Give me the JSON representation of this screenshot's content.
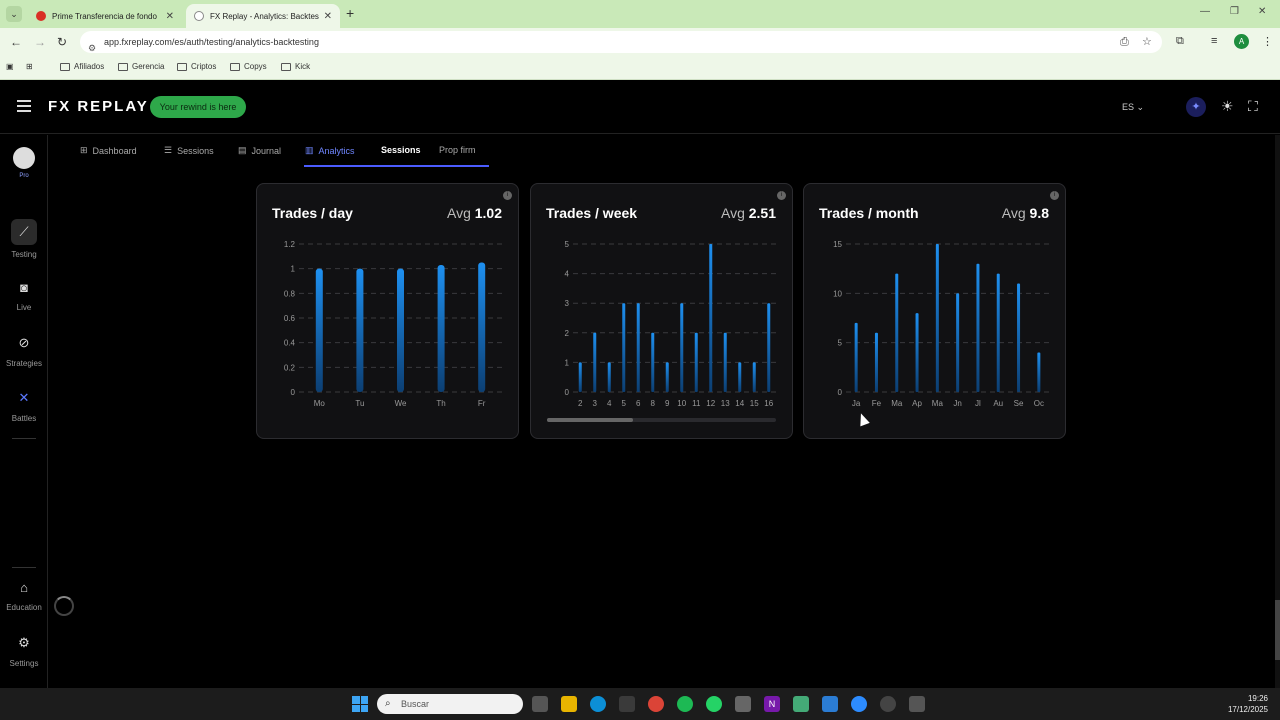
{
  "browser": {
    "tabs": [
      {
        "title": "Prime Transferencia de fondo",
        "favicon_color": "#d93025"
      },
      {
        "title": "FX Replay - Analytics: Backtes",
        "favicon_color": "#ffffff"
      }
    ],
    "url": "app.fxreplay.com/es/auth/testing/analytics-backtesting",
    "bookmarks": [
      "Afiliados",
      "Gerencia",
      "Criptos",
      "Copys",
      "Kick"
    ],
    "profile_initial": "A"
  },
  "header": {
    "logo": "FX REPLAY",
    "rewind_label": "Your rewind is here",
    "lang": "ES"
  },
  "sidebar": {
    "pro_label": "Pro",
    "items": [
      {
        "label": "Testing",
        "icon": "chart-line-icon"
      },
      {
        "label": "Live",
        "icon": "camera-icon"
      },
      {
        "label": "Strategies",
        "icon": "compass-icon"
      },
      {
        "label": "Battles",
        "icon": "swords-icon"
      },
      {
        "label": "Education",
        "icon": "graduation-cap-icon"
      },
      {
        "label": "Settings",
        "icon": "gear-icon"
      }
    ]
  },
  "subnav": {
    "items": [
      {
        "label": "Dashboard",
        "icon": "grid-icon"
      },
      {
        "label": "Sessions",
        "icon": "list-icon"
      },
      {
        "label": "Journal",
        "icon": "notebook-icon"
      },
      {
        "label": "Analytics",
        "icon": "bar-chart-icon"
      },
      {
        "label": "Sessions",
        "icon": ""
      },
      {
        "label": "Prop firm",
        "icon": ""
      }
    ]
  },
  "cards": {
    "day": {
      "title": "Trades / day",
      "avg_label": "Avg",
      "avg_value": "1.02"
    },
    "week": {
      "title": "Trades / week",
      "avg_label": "Avg",
      "avg_value": "2.51"
    },
    "month": {
      "title": "Trades / month",
      "avg_label": "Avg",
      "avg_value": "9.8"
    }
  },
  "chart_data": [
    {
      "type": "bar",
      "title": "Trades / day",
      "categories": [
        "Mo",
        "Tu",
        "We",
        "Th",
        "Fr"
      ],
      "values": [
        1.0,
        1.0,
        1.0,
        1.03,
        1.05
      ],
      "ylim": [
        0,
        1.2
      ],
      "yticks": [
        "0",
        "0.2",
        "0.4",
        "0.6",
        "0.8",
        "1",
        "1.2"
      ],
      "grid": true
    },
    {
      "type": "bar",
      "title": "Trades / week",
      "categories": [
        "2",
        "3",
        "4",
        "5",
        "6",
        "8",
        "9",
        "10",
        "11",
        "12",
        "13",
        "14",
        "15",
        "16"
      ],
      "values": [
        1,
        2,
        1,
        3,
        3,
        2,
        1,
        3,
        2,
        5,
        2,
        1,
        1,
        3
      ],
      "ylim": [
        0,
        5
      ],
      "yticks": [
        "0",
        "1",
        "2",
        "3",
        "4",
        "5"
      ],
      "grid": true
    },
    {
      "type": "bar",
      "title": "Trades / month",
      "categories": [
        "Ja",
        "Fe",
        "Ma",
        "Ap",
        "Ma",
        "Jn",
        "Jl",
        "Au",
        "Se",
        "Oc"
      ],
      "values": [
        7,
        6,
        12,
        8,
        15,
        10,
        13,
        12,
        11,
        4
      ],
      "ylim": [
        0,
        15
      ],
      "yticks": [
        "0",
        "5",
        "10",
        "15"
      ],
      "grid": true
    }
  ],
  "taskbar": {
    "search_placeholder": "Buscar",
    "time": "19:26",
    "date": "17/12/2025"
  },
  "colors": {
    "accent": "#4b5cff",
    "bar": "#1e90f0",
    "rewind_bg": "#2ea84a"
  }
}
